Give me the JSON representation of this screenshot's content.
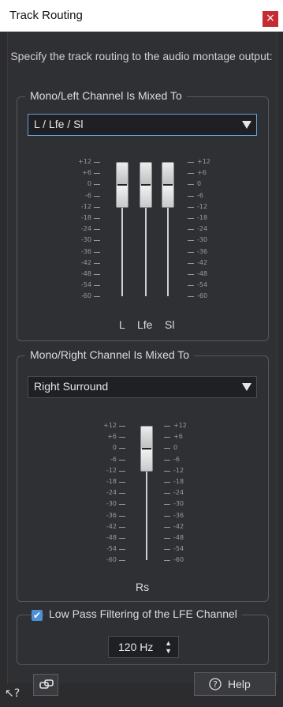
{
  "window": {
    "title": "Track Routing",
    "close_label": "×"
  },
  "description": "Specify the track routing to the audio montage output:",
  "left_group": {
    "title": "Mono/Left Channel Is Mixed To",
    "select_value": "L / Lfe / Sl",
    "channels": [
      "L",
      "Lfe",
      "Sl"
    ]
  },
  "right_group": {
    "title": "Mono/Right Channel Is Mixed To",
    "select_value": "Right Surround",
    "channels": [
      "Rs"
    ]
  },
  "scale_labels": [
    "+12",
    "+6",
    "0",
    "-6",
    "-12",
    "-18",
    "-24",
    "-30",
    "-36",
    "-42",
    "-48",
    "-54",
    "-60"
  ],
  "lfe": {
    "checkbox_label": "Low Pass Filtering of the LFE Channel",
    "checked": true,
    "frequency": "120 Hz"
  },
  "footer": {
    "help_label": "Help",
    "help_icon": "question-circle-icon",
    "link_icon": "link-icon",
    "whats_this_icon": "whats-this-icon"
  }
}
